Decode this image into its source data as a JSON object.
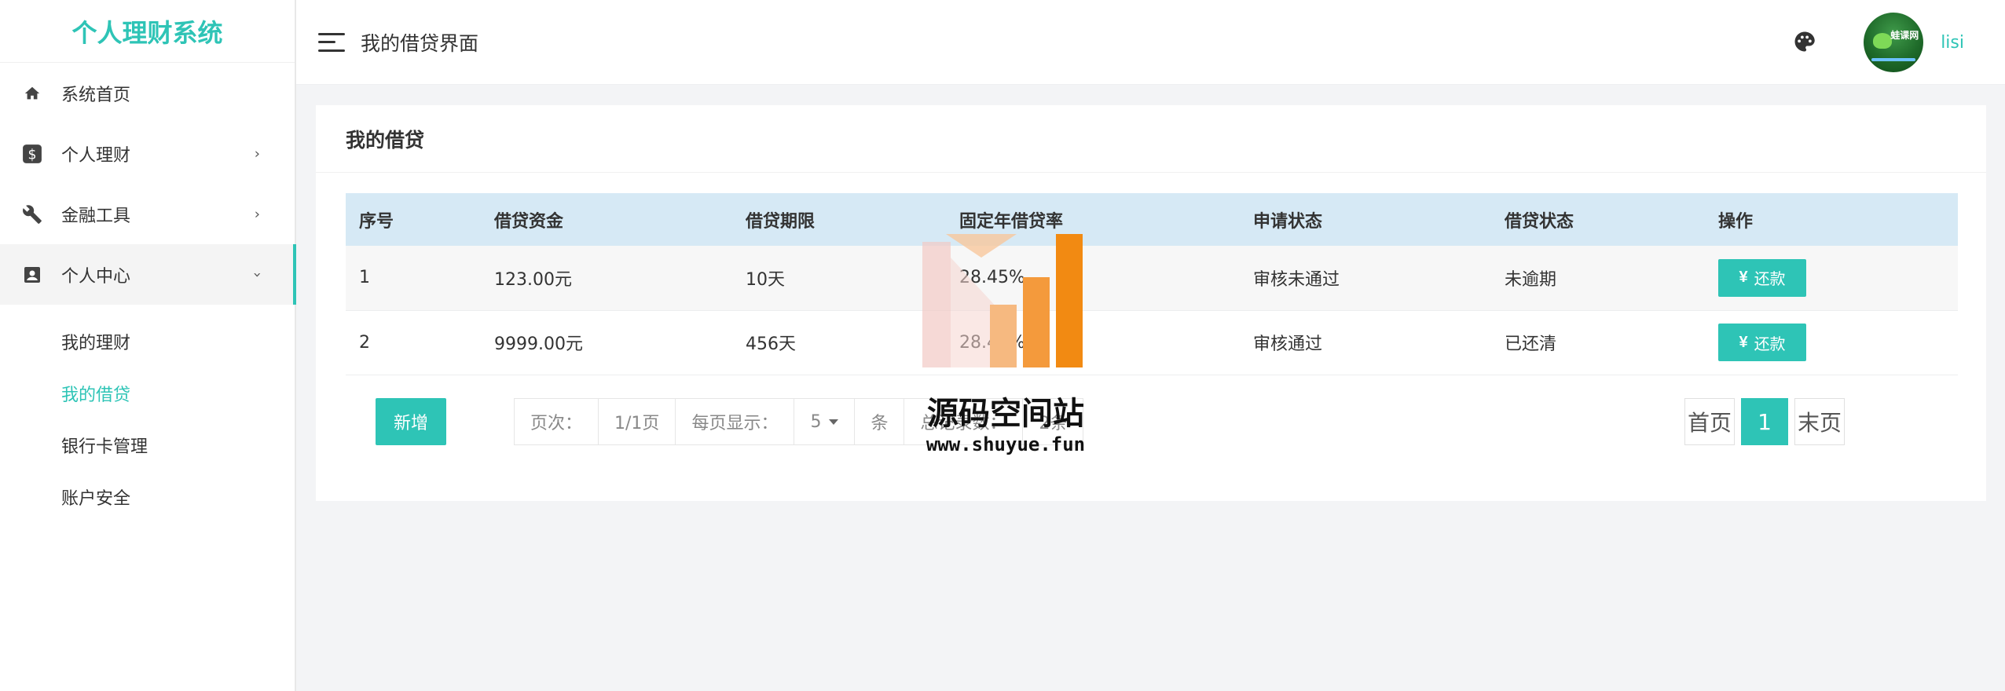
{
  "sidebar": {
    "brand": "个人理财系统",
    "items": [
      {
        "label": "系统首页",
        "icon": "home-icon"
      },
      {
        "label": "个人理财",
        "icon": "dollar-icon"
      },
      {
        "label": "金融工具",
        "icon": "wrench-icon"
      },
      {
        "label": "个人中心",
        "icon": "user-card-icon"
      }
    ],
    "sub_items": [
      {
        "label": "我的理财"
      },
      {
        "label": "我的借贷",
        "active": true
      },
      {
        "label": "银行卡管理"
      },
      {
        "label": "账户安全"
      }
    ]
  },
  "header": {
    "title": "我的借贷界面",
    "username": "lisi",
    "avatar_text": "蛙课网"
  },
  "card": {
    "title": "我的借贷"
  },
  "table": {
    "columns": [
      "序号",
      "借贷资金",
      "借贷期限",
      "固定年借贷率",
      "申请状态",
      "借贷状态",
      "操作"
    ],
    "rows": [
      {
        "index": "1",
        "amount": "123.00元",
        "term": "10天",
        "rate": "28.45%",
        "apply_status": "审核未通过",
        "loan_status": "未逾期",
        "action": "还款"
      },
      {
        "index": "2",
        "amount": "9999.00元",
        "term": "456天",
        "rate": "28.45%",
        "apply_status": "审核通过",
        "loan_status": "已还清",
        "action": "还款"
      }
    ]
  },
  "toolbar": {
    "add_label": "新增"
  },
  "pager": {
    "page_label": "页次：",
    "page_value": "1/1页",
    "per_page_label": "每页显示：",
    "per_page_value": "5",
    "unit": "条",
    "total_label": "总记录数：",
    "total_value": "2条"
  },
  "pagination": {
    "first": "首页",
    "current": "1",
    "last": "末页"
  },
  "watermark": {
    "title": "源码空间站",
    "url": "www.shuyue.fun"
  },
  "colors": {
    "accent": "#2ec4b6",
    "table_header": "#d6e9f5"
  }
}
